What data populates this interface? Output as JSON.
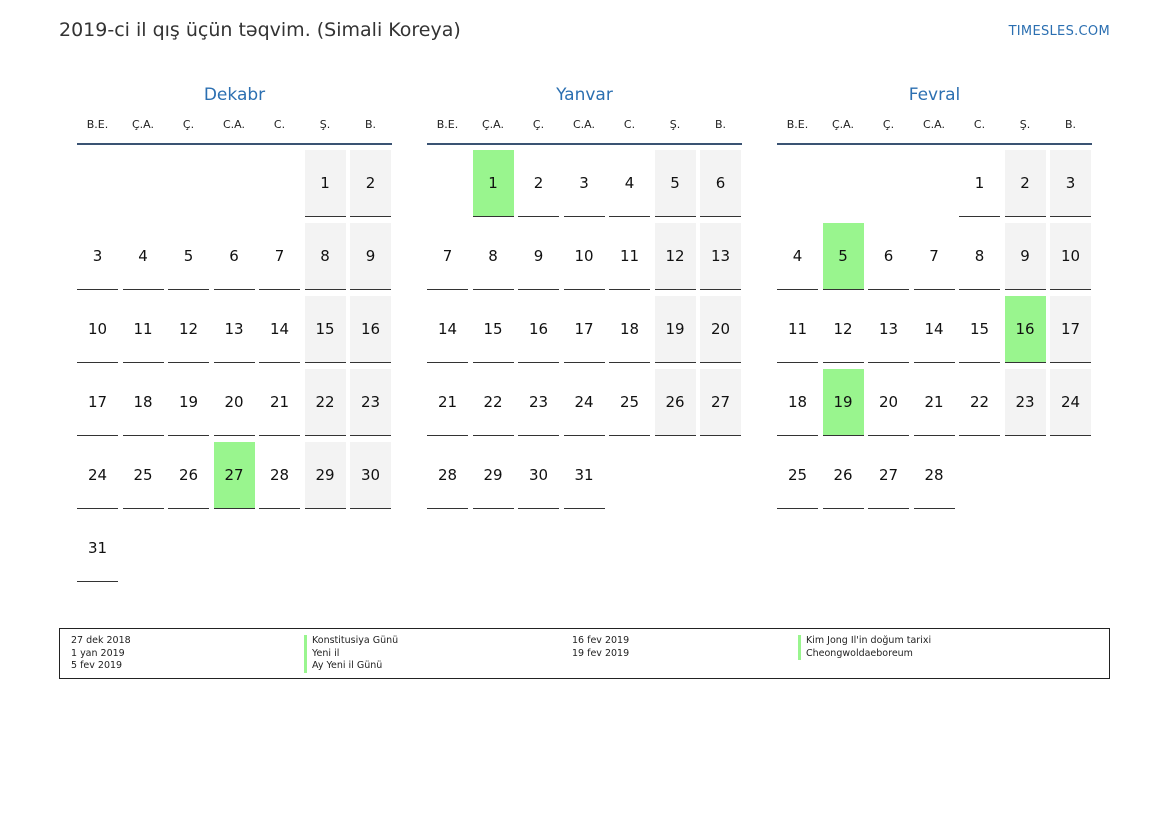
{
  "header": {
    "title": "2019-ci il qış üçün təqvim. (Simali Koreya)",
    "site": "TIMESLES.COM"
  },
  "weekdays": [
    "B.E.",
    "Ç.A.",
    "Ç.",
    "C.A.",
    "C.",
    "Ş.",
    "B."
  ],
  "months": [
    {
      "name": "Dekabr",
      "first_weekday": 5,
      "days": 31,
      "holidays": [
        27
      ]
    },
    {
      "name": "Yanvar",
      "first_weekday": 1,
      "days": 31,
      "holidays": [
        1
      ]
    },
    {
      "name": "Fevral",
      "first_weekday": 4,
      "days": 28,
      "holidays": [
        5,
        16,
        19
      ]
    }
  ],
  "legend": {
    "left_dates": [
      "27 dek 2018",
      "1 yan 2019",
      "5 fev 2019"
    ],
    "left_names": [
      "Konstitusiya Günü",
      "Yeni il",
      "Ay Yeni il Günü"
    ],
    "right_dates": [
      "16 fev 2019",
      "19 fev 2019"
    ],
    "right_names": [
      "Kim Jong Il'in doğum tarixi",
      "Cheongwoldaeboreum"
    ]
  },
  "colors": {
    "accent": "#2b6fb1",
    "holiday": "#99f58e",
    "weekend": "#f3f3f3",
    "rule": "#3a5373"
  }
}
